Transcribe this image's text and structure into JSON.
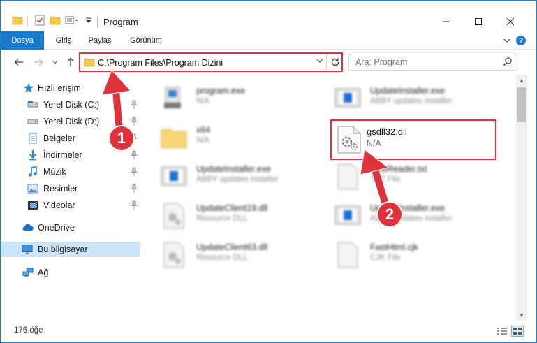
{
  "window": {
    "title": "Program",
    "minimize_icon": "minimize-icon",
    "maximize_icon": "maximize-icon",
    "close_icon": "close-icon"
  },
  "ribbon": {
    "tabs": [
      {
        "label": "Dosya",
        "active": true
      },
      {
        "label": "Giriş",
        "active": false
      },
      {
        "label": "Paylaş",
        "active": false
      },
      {
        "label": "Görünüm",
        "active": false
      }
    ]
  },
  "address": {
    "path": "C:\\Program Files\\Program Dizini",
    "search_placeholder": "Ara: Program"
  },
  "nav": {
    "items": [
      {
        "label": "Hızlı erişim",
        "icon": "star-icon",
        "pinned": false
      },
      {
        "label": "Yerel Disk (C:)",
        "icon": "drive-icon",
        "pinned": true
      },
      {
        "label": "Yerel Disk (D:)",
        "icon": "drive-icon",
        "pinned": true
      },
      {
        "label": "Belgeler",
        "icon": "documents-icon",
        "pinned": true
      },
      {
        "label": "İndirmeler",
        "icon": "downloads-icon",
        "pinned": true
      },
      {
        "label": "Müzik",
        "icon": "music-icon",
        "pinned": true
      },
      {
        "label": "Resimler",
        "icon": "pictures-icon",
        "pinned": true
      },
      {
        "label": "Videolar",
        "icon": "videos-icon",
        "pinned": true
      },
      {
        "label": "OneDrive",
        "icon": "cloud-icon",
        "pinned": false
      },
      {
        "label": "Bu bilgisayar",
        "icon": "computer-icon",
        "pinned": false,
        "selected": true
      },
      {
        "label": "Ağ",
        "icon": "network-icon",
        "pinned": false
      }
    ]
  },
  "files": [
    {
      "name": "program.exe",
      "type": "N/A",
      "icon": "exe-icon"
    },
    {
      "name": "UpdateInstaller.exe",
      "type": "ABBY updates installer",
      "icon": "installer-icon"
    },
    {
      "name": "x64",
      "type": "N/A",
      "icon": "folder-icon"
    },
    {
      "name": "gsdll32.dll",
      "type": "N/A",
      "icon": "dll-icon",
      "highlighted": true
    },
    {
      "name": "UpdateInstaller.exe",
      "type": "ABBY updates installer",
      "icon": "installer-icon"
    },
    {
      "name": "FineReader.txt",
      "type": "TXT File",
      "icon": "text-file-icon"
    },
    {
      "name": "UpdateClient19.dll",
      "type": "Resource DLL",
      "icon": "dll-icon"
    },
    {
      "name": "UpdateInstaller.exe",
      "type": "ABBY updates installer",
      "icon": "installer-icon"
    },
    {
      "name": "UpdateClient63.dll",
      "type": "Resource DLL",
      "icon": "dll-icon"
    },
    {
      "name": "FastHtml.cjk",
      "type": "CJK File",
      "icon": "generic-file-icon"
    }
  ],
  "status": {
    "item_count": "176 öğe"
  },
  "callouts": [
    {
      "number": "1"
    },
    {
      "number": "2"
    }
  ],
  "colors": {
    "accent": "#1979ca",
    "highlight": "#e0323a"
  }
}
